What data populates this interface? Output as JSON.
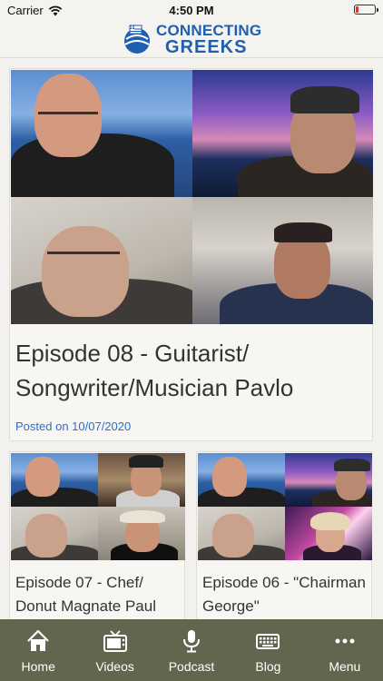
{
  "status_bar": {
    "carrier": "Carrier",
    "time": "4:50 PM"
  },
  "header": {
    "logo_line1": "CONNECTING",
    "logo_line2": "GREEKS"
  },
  "featured": {
    "title": "Episode 08 - Guitarist/ Songwriter/Musician Pavlo",
    "date": "Posted on 10/07/2020"
  },
  "cards": [
    {
      "title": "Episode 07 - Chef/ Donut Magnate Paul"
    },
    {
      "title": "Episode 06 - \"Chairman George\""
    }
  ],
  "tabs": [
    {
      "label": "Home",
      "icon": "home-icon"
    },
    {
      "label": "Videos",
      "icon": "tv-icon"
    },
    {
      "label": "Podcast",
      "icon": "microphone-icon"
    },
    {
      "label": "Blog",
      "icon": "keyboard-icon"
    },
    {
      "label": "Menu",
      "icon": "more-icon"
    }
  ],
  "colors": {
    "accent": "#2a70c8",
    "tabbar": "#64654f",
    "logo": "#1f5fb0"
  }
}
